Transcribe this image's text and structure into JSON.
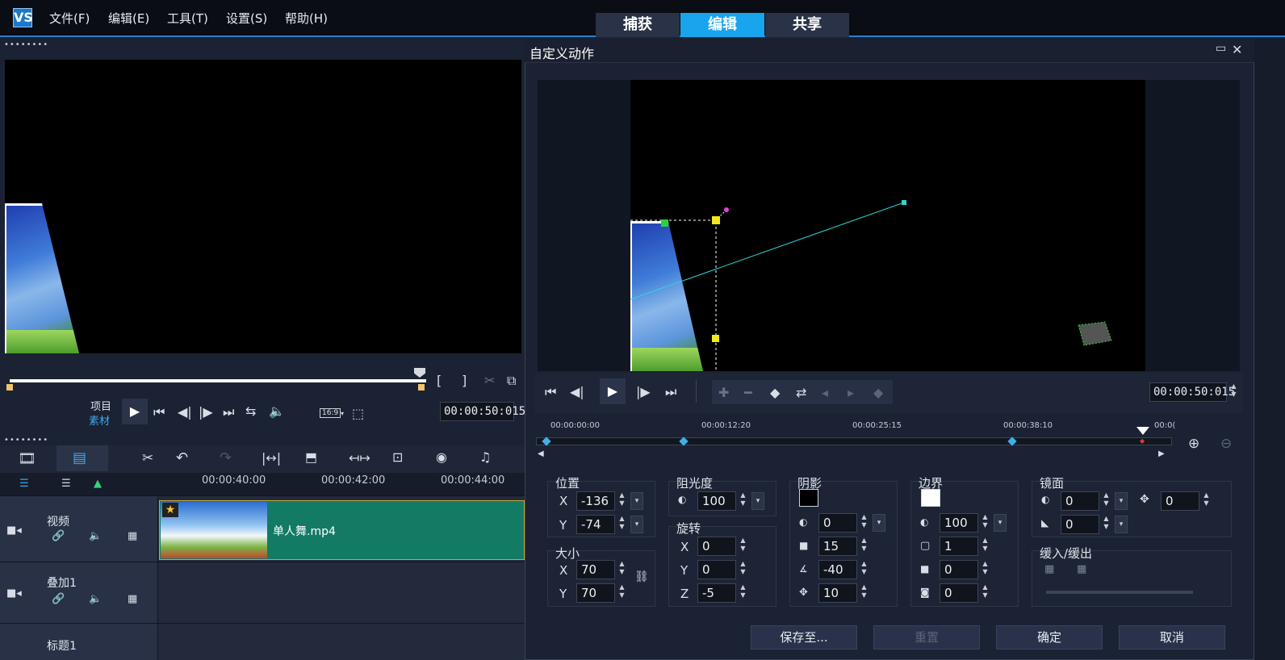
{
  "app": {
    "logo": "VS"
  },
  "menu": [
    "文件(F)",
    "编辑(E)",
    "工具(T)",
    "设置(S)",
    "帮助(H)"
  ],
  "tabs": {
    "capture": "捕获",
    "edit": "编辑",
    "share": "共享"
  },
  "player": {
    "mode_project": "项目",
    "mode_clip": "素材",
    "timecode": "00:00:50:015",
    "aspect": "16:9",
    "mark_in": "[",
    "mark_out": "]"
  },
  "timeline": {
    "ruler": [
      "00:00:40:00",
      "00:00:42:00",
      "00:00:44:00"
    ],
    "tracks": [
      {
        "name": "视频",
        "clip": "单人舞.mp4"
      },
      {
        "name": "叠加1"
      },
      {
        "name": "标题1"
      }
    ]
  },
  "dialog": {
    "title": "自定义动作",
    "timecode": "00:00:50:015",
    "ruler": [
      "00:00:00:00",
      "00:00:12:20",
      "00:00:25:15",
      "00:00:38:10",
      "00:0("
    ],
    "position": {
      "label": "位置",
      "x_label": "X",
      "y_label": "Y",
      "x": "-136",
      "y": "-74"
    },
    "size": {
      "label": "大小",
      "x_label": "X",
      "y_label": "Y",
      "x": "70",
      "y": "70"
    },
    "opacity": {
      "label": "阻光度",
      "value": "100"
    },
    "rotation": {
      "label": "旋转",
      "x_label": "X",
      "y_label": "Y",
      "z_label": "Z",
      "x": "0",
      "y": "0",
      "z": "-5"
    },
    "shadow": {
      "label": "阴影",
      "color": "#000000",
      "opacity": "0",
      "blur": "15",
      "angle": "-40",
      "distance": "10"
    },
    "border": {
      "label": "边界",
      "color": "#ffffff",
      "opacity": "100",
      "width": "1",
      "v2": "0",
      "v3": "0"
    },
    "mirror": {
      "label": "镜面",
      "opacity": "0",
      "offset": "0",
      "fade": "0"
    },
    "ease": {
      "label": "缓入/缓出"
    },
    "buttons": {
      "save_to": "保存至...",
      "reset": "重置",
      "ok": "确定",
      "cancel": "取消"
    }
  },
  "colors": {
    "accent": "#19a4ee",
    "clip": "#137a64",
    "keyframe": "#3fb0e6",
    "path": "#2fd6d6"
  }
}
